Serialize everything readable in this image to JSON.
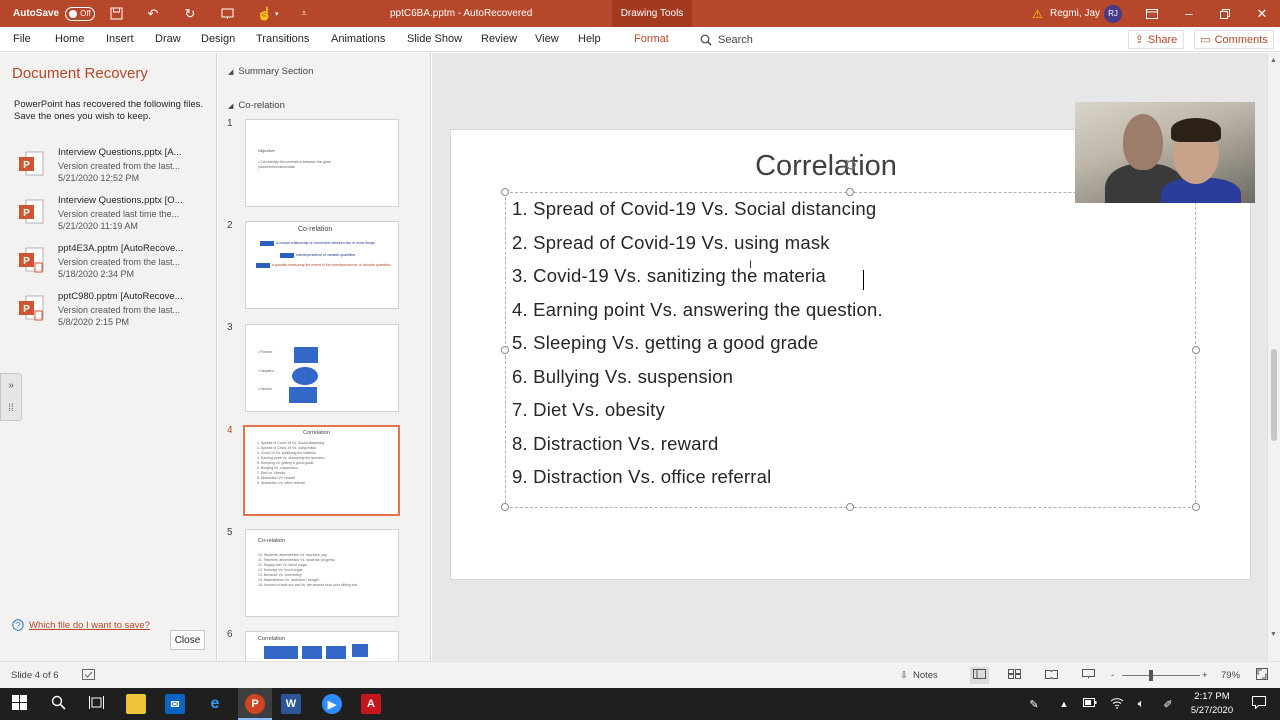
{
  "titlebar": {
    "autosave_label": "AutoSave",
    "autosave_state": "Off",
    "doc_title": "pptC6BA.pptm - AutoRecovered",
    "contextual_tab": "Drawing Tools",
    "user_name": "Regmi, Jay",
    "user_initials": "RJ"
  },
  "menu": {
    "items": [
      "File",
      "Home",
      "Insert",
      "Draw",
      "Design",
      "Transitions",
      "Animations",
      "Slide Show",
      "Review",
      "View",
      "Help",
      "Format"
    ],
    "search_label": "Search",
    "share_label": "Share",
    "comments_label": "Comments"
  },
  "recovery": {
    "title": "Document Recovery",
    "description": "PowerPoint has recovered the following files.  Save the ones you wish to keep.",
    "files": [
      {
        "name": "Interview Questions.pptx  [A...",
        "line1": "Version created from the last...",
        "line2": "5/21/2020 12:52 PM"
      },
      {
        "name": "Interview Questions.pptx  [O...",
        "line1": "Version created last time the...",
        "line2": "5/21/2020 11:19 AM"
      },
      {
        "name": "ppt4E3A.pptm  [AutoRecove...",
        "line1": "Version created from the last...",
        "line2": "5/18/2020 2:34 PM"
      },
      {
        "name": "pptC980.pptm  [AutoRecove...",
        "line1": "Version created from the last...",
        "line2": "5/8/2020 2:15 PM"
      }
    ],
    "which_file_link": "Which file do I want to save?",
    "close_label": "Close"
  },
  "thumbnails": {
    "section1": "Summary Section",
    "section2": "Co-relation",
    "slide_numbers": [
      "1",
      "2",
      "3",
      "4",
      "5",
      "6"
    ],
    "s1_title": "Objective",
    "s1_lines": [
      "• Can identify the correlation between the given",
      "  picture/information/data."
    ],
    "s2_title": "Co-relation",
    "s2_lines": [
      "A mutual relationship or connection between two or more things.",
      "interdependence of variable quantities.",
      "a quantity measuring the extent of the interdependence of variable quantities."
    ],
    "s3_labels": [
      "• Positive",
      "• Negative",
      "• Neutral"
    ],
    "s4_title": "Correlation",
    "s4_lines": [
      "1. Spread of Covid-19  Vs. Social distancing",
      "2. Spread of Covid-19 Vs. using mask",
      "3. Covid-19 Vs. sanitizing the material",
      "4. Earning point Vs. answering the question.",
      "5. Sleeping Vs. getting a good grade",
      "6. Bullying Vs. suspension",
      "7. Diet Vs. obesity",
      "8. Distraction Vs. reward",
      "9. Distraction Vs. office referral"
    ],
    "s5_title": "Co-relation",
    "s5_lines": [
      "10. Students' absenteeism Vs. teachers' pay",
      "11. Teachers' absenteeism Vs. students' progress",
      "12. Sugary diet Vs. blood sugar",
      "13. Exercise Vs. blood sugar",
      "14. Behavior Vs. counseling",
      "15. Absenteeism Vs. tardiness / budget",
      "16. Amount of food you eat Vs. the amount food your sibling eat"
    ],
    "s6_title": "Correlation"
  },
  "slide": {
    "title": "Correlation",
    "bullets": [
      "1. Spread of Covid-19   Vs. Social distancing",
      "2. Spread of Covid-19 Vs. using mask",
      "3. Covid-19 Vs. sanitizing the materia",
      "4. Earning point Vs. answering the question.",
      "5. Sleeping Vs. getting a good grade",
      "6. Bullying Vs. suspension",
      "7. Diet Vs. obesity",
      "8. Distraction Vs. reward",
      "9. Distraction Vs. office referral"
    ]
  },
  "status": {
    "slide_indicator": "Slide 4 of 6",
    "notes_label": "Notes",
    "zoom_minus": "-",
    "zoom_plus": "+",
    "zoom_level": "79%"
  },
  "taskbar": {
    "time": "2:17 PM",
    "date": "5/27/2020"
  },
  "colors": {
    "accent": "#b7472a",
    "active_thumb_border": "#e3744f",
    "taskbar": "#1f1f1f"
  }
}
